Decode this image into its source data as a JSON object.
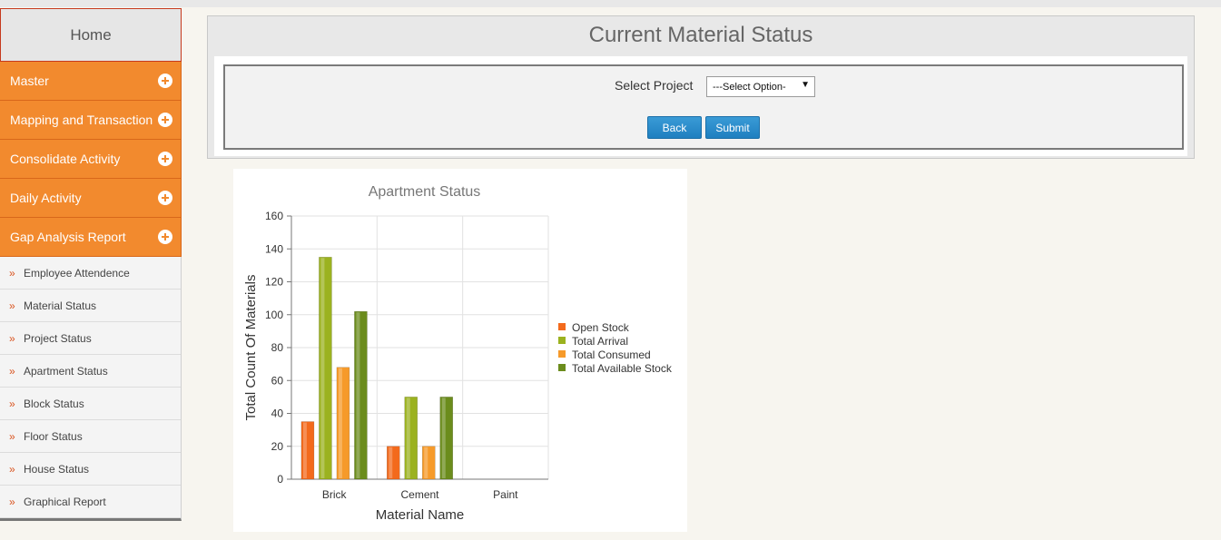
{
  "sidebar": {
    "home": "Home",
    "menus": [
      {
        "label": "Master"
      },
      {
        "label": "Mapping and Transaction"
      },
      {
        "label": "Consolidate Activity"
      },
      {
        "label": "Daily Activity"
      },
      {
        "label": "Gap Analysis Report"
      }
    ],
    "sub_items": [
      {
        "label": "Employee Attendence"
      },
      {
        "label": "Material Status"
      },
      {
        "label": "Project Status"
      },
      {
        "label": "Apartment Status"
      },
      {
        "label": "Block Status"
      },
      {
        "label": "Floor Status"
      },
      {
        "label": "House Status"
      },
      {
        "label": "Graphical Report"
      }
    ],
    "bullet": "»"
  },
  "panel": {
    "title": "Current Material Status",
    "select_label": "Select Project",
    "select_value": "---Select Option-",
    "back_label": "Back",
    "submit_label": "Submit"
  },
  "colors": {
    "accent": "#f28a2e",
    "button": "#2a8dcc",
    "series": [
      "#f36a1c",
      "#9bb21f",
      "#f69a2a",
      "#6b8c1c"
    ]
  },
  "chart_data": {
    "type": "bar",
    "title": "Apartment Status",
    "xlabel": "Material Name",
    "ylabel": "Total Count Of Materials",
    "categories": [
      "Brick",
      "Cement",
      "Paint"
    ],
    "ylim": [
      0,
      160
    ],
    "yticks": [
      0,
      20,
      40,
      60,
      80,
      100,
      120,
      140,
      160
    ],
    "grid": true,
    "legend_position": "right",
    "series": [
      {
        "name": "Open Stock",
        "values": [
          35,
          20,
          0
        ]
      },
      {
        "name": "Total Arrival",
        "values": [
          135,
          50,
          0
        ]
      },
      {
        "name": "Total Consumed",
        "values": [
          68,
          20,
          0
        ]
      },
      {
        "name": "Total Available Stock",
        "values": [
          102,
          50,
          0
        ]
      }
    ]
  }
}
